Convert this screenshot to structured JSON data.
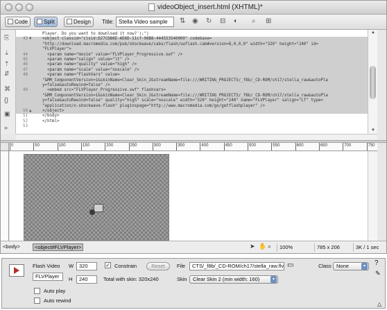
{
  "window": {
    "title": "videoObject_insert.html (XHTML)*"
  },
  "toolbar": {
    "code_label": "Code",
    "split_label": "Split",
    "design_label": "Design",
    "title_label": "Title:",
    "title_value": "Stella Video sample"
  },
  "code": {
    "lines": [
      {
        "num": "",
        "arrow": "",
        "text": "Player. Do you want to download it now?');\")",
        "selected": false
      },
      {
        "num": "43",
        "arrow": "▼",
        "text": "<object classid=\"clsid:D27CDB6E-AE6D-11cf-96B8-444553540000\" codebase=",
        "selected": true
      },
      {
        "num": "",
        "arrow": "",
        "text": "\"http://download.macromedia.com/pub/shockwave/cabs/flash/swflash.cab#version=8,0,0,0\" width=\"320\" height=\"240\" id=",
        "selected": true
      },
      {
        "num": "",
        "arrow": "",
        "text": "\"FLVPlayer\">",
        "selected": true
      },
      {
        "num": "44",
        "arrow": "",
        "text": "  <param name=\"movie\" value=\"FLVPlayer_Progressive.swf\" />",
        "selected": true
      },
      {
        "num": "45",
        "arrow": "",
        "text": "  <param name=\"salign\" value=\"lt\" />",
        "selected": true
      },
      {
        "num": "46",
        "arrow": "",
        "text": "  <param name=\"quality\" value=\"high\" />",
        "selected": true
      },
      {
        "num": "47",
        "arrow": "",
        "text": "  <param name=\"scale\" value=\"noscale\" />",
        "selected": true
      },
      {
        "num": "48",
        "arrow": "",
        "text": "  <param name=\"FlashVars\" value=",
        "selected": true
      },
      {
        "num": "",
        "arrow": "",
        "text": "\"&MM_ComponentVersion=1&skinName=Clear_Skin_2&streamName=file:///WRITING_PROJECTS/_f8b/_CD-ROM/ch17/stella_raw&autoPla",
        "selected": true
      },
      {
        "num": "",
        "arrow": "",
        "text": "y=false&autoRewind=false\" />",
        "selected": true
      },
      {
        "num": "49",
        "arrow": "",
        "text": "  <embed src=\"FLVPlayer_Progressive.swf\" flashvars=",
        "selected": true
      },
      {
        "num": "",
        "arrow": "",
        "text": "\"&MM_ComponentVersion=1&skinName=Clear_Skin_2&streamName=file:///WRITING_PROJECTS/_f8b/_CD-ROM/ch17/stella_raw&autoPla",
        "selected": true
      },
      {
        "num": "",
        "arrow": "",
        "text": "y=false&autoRewind=false\" quality=\"high\" scale=\"noscale\" width=\"320\" height=\"240\" name=\"FLVPlayer\" salign=\"LT\" type=",
        "selected": true
      },
      {
        "num": "",
        "arrow": "",
        "text": "\"application/x-shockwave-flash\" pluginspage=\"http://www.macromedia.com/go/getflashplayer\" />",
        "selected": true
      },
      {
        "num": "50",
        "arrow": "▲",
        "text": "</object>",
        "selected": true
      },
      {
        "num": "51",
        "arrow": "",
        "text": "</body>",
        "selected": false
      },
      {
        "num": "52",
        "arrow": "",
        "text": "</html>",
        "selected": false
      },
      {
        "num": "53",
        "arrow": "",
        "text": "",
        "selected": false
      }
    ]
  },
  "ruler": {
    "marks": [
      "0",
      "50",
      "100",
      "150",
      "200",
      "250",
      "300",
      "350",
      "400",
      "450",
      "500",
      "550",
      "600",
      "650",
      "700",
      "750"
    ]
  },
  "status": {
    "tag_body": "<body>",
    "tag_object": "<object#FLVPlayer>",
    "zoom": "100%",
    "dimensions": "785 x 206",
    "download": "3K / 1 sec"
  },
  "properties": {
    "type_label": "Flash Video",
    "name_value": "FLVPlayer",
    "w_label": "W",
    "w_value": "320",
    "h_label": "H",
    "h_value": "240",
    "constrain_label": "Constrain",
    "constrain_checked": "✓",
    "reset_label": "Reset",
    "total_label": "Total with skin: 320x240",
    "file_label": "File",
    "file_value": "CTS/_f8b/_CD-ROM/ch17/stella_raw.flv",
    "skin_label": "Skin",
    "skin_value": "Clear Skin 2 (min width: 160)",
    "class_label": "Class",
    "class_value": "None",
    "autoplay_label": "Auto play",
    "autorewind_label": "Auto rewind"
  }
}
